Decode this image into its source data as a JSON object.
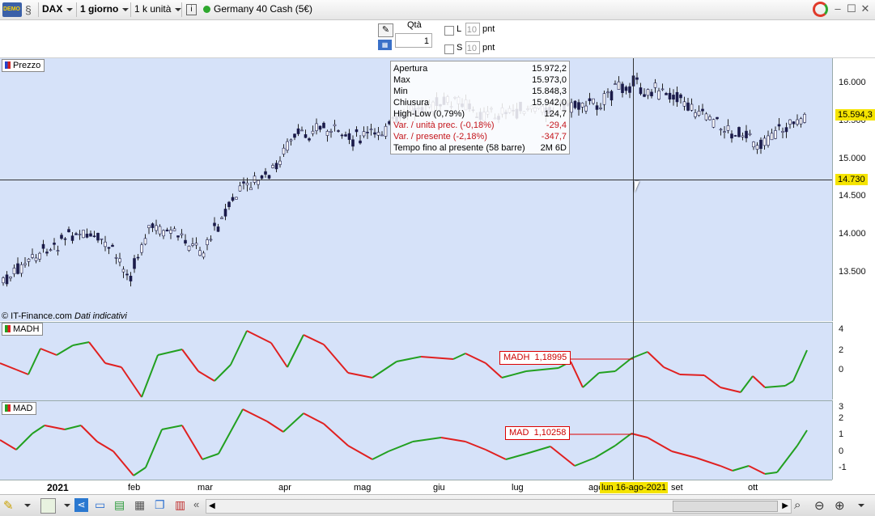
{
  "toolbar": {
    "demo_label": "DEMO",
    "symbol": "DAX",
    "timeframe": "1 giorno",
    "units": "1 k unità",
    "instrument": "Germany 40 Cash (5€)"
  },
  "order": {
    "qty_label": "Qtà",
    "qty_value": "1",
    "l_label": "L",
    "l_value": "10",
    "s_label": "S",
    "s_value": "10",
    "pnt_label": "pnt",
    "pnt_label2": "pnt"
  },
  "price_panel": {
    "label": "Prezzo",
    "copyright": "© IT-Finance.com",
    "copyright_note": "Dati indicativi",
    "scale_ticks": [
      "16.000",
      "15.500",
      "15.000",
      "14.500",
      "14.000",
      "13.500"
    ],
    "last_price": "15.594,3",
    "cursor_price": "14.730"
  },
  "tooltip": {
    "rows": [
      {
        "k": "Apertura",
        "v": "15.972,2",
        "red": false
      },
      {
        "k": "Max",
        "v": "15.973,0",
        "red": false
      },
      {
        "k": "Min",
        "v": "15.848,3",
        "red": false
      },
      {
        "k": "Chiusura",
        "v": "15.942,0",
        "red": false
      },
      {
        "k": "High-Low (0,79%)",
        "v": "124,7",
        "red": false
      },
      {
        "k": "Var. / unità prec. (-0,18%)",
        "v": "-29,4",
        "red": true
      },
      {
        "k": "Var. / presente (-2,18%)",
        "v": "-347,7",
        "red": true
      },
      {
        "k": "Tempo fino al presente (58 barre)",
        "v": "2M 6D",
        "red": false
      }
    ]
  },
  "madh_panel": {
    "label": "MADH",
    "value_label": "MADH",
    "value": "1,18995",
    "scale_ticks": [
      "4",
      "2",
      "0"
    ]
  },
  "mad_panel": {
    "label": "MAD",
    "value_label": "MAD",
    "value": "1,10258",
    "scale_ticks": [
      "3",
      "2",
      "1",
      "0",
      "-1"
    ]
  },
  "timeaxis": {
    "year": "2021",
    "months": [
      "feb",
      "mar",
      "apr",
      "mag",
      "giu",
      "lug",
      "ago",
      "set",
      "ott"
    ],
    "cursor_date": "lun 16-ago-2021"
  },
  "colors": {
    "panel_bg": "#d6e2f9",
    "up": "#22a020",
    "down": "#e02020",
    "cursor_tag": "#f5e400"
  }
}
